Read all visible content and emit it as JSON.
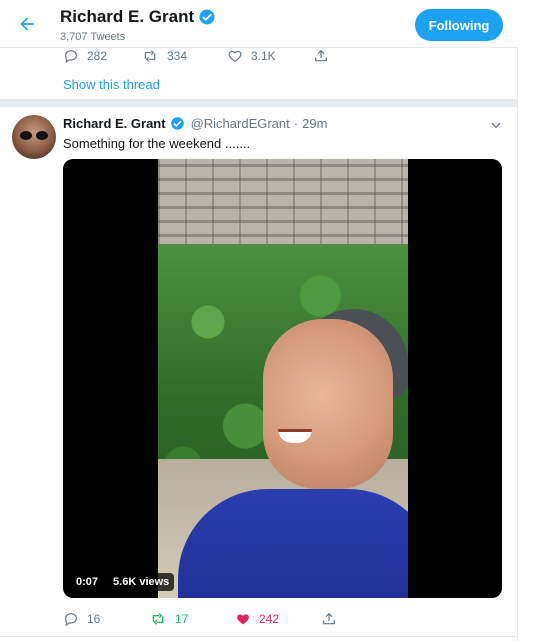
{
  "header": {
    "title": "Richard E. Grant",
    "subtitle": "3,707 Tweets",
    "follow_label": "Following"
  },
  "prev_tweet": {
    "replies": "282",
    "retweets": "334",
    "likes": "3.1K",
    "show_thread": "Show this thread"
  },
  "tweet": {
    "name": "Richard E. Grant",
    "handle": "@RichardEGrant",
    "dot": "·",
    "time": "29m",
    "text": "Something for the weekend .......",
    "video": {
      "duration": "0:07",
      "views": "5.6K views"
    },
    "replies": "16",
    "retweets": "17",
    "likes": "242"
  },
  "colors": {
    "accent": "#1da1f2",
    "retweet": "#17bf63",
    "like": "#e0245e",
    "muted": "#657786"
  }
}
